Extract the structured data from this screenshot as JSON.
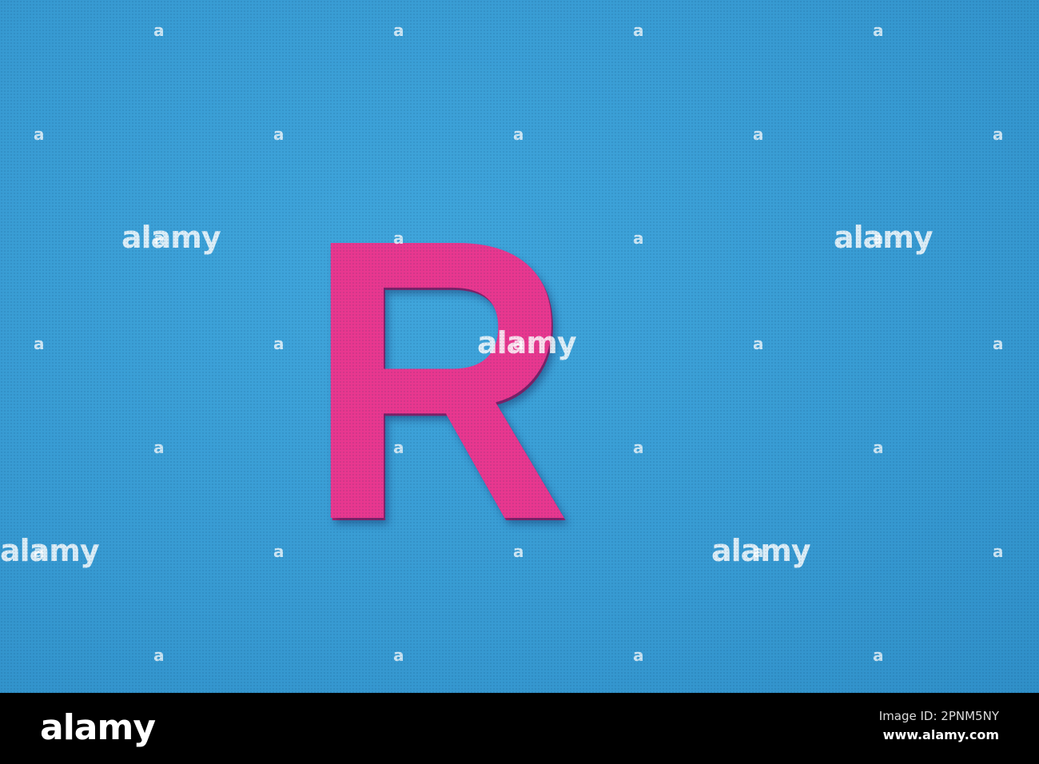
{
  "photo": {
    "letter": "R",
    "background_color": "#379ad2",
    "letter_color": "#e8378f"
  },
  "watermark": {
    "text": "alamy",
    "mark": "a"
  },
  "footer": {
    "logo": "alamy",
    "image_id": "Image ID: 2PNM5NY",
    "website": "www.alamy.com"
  }
}
